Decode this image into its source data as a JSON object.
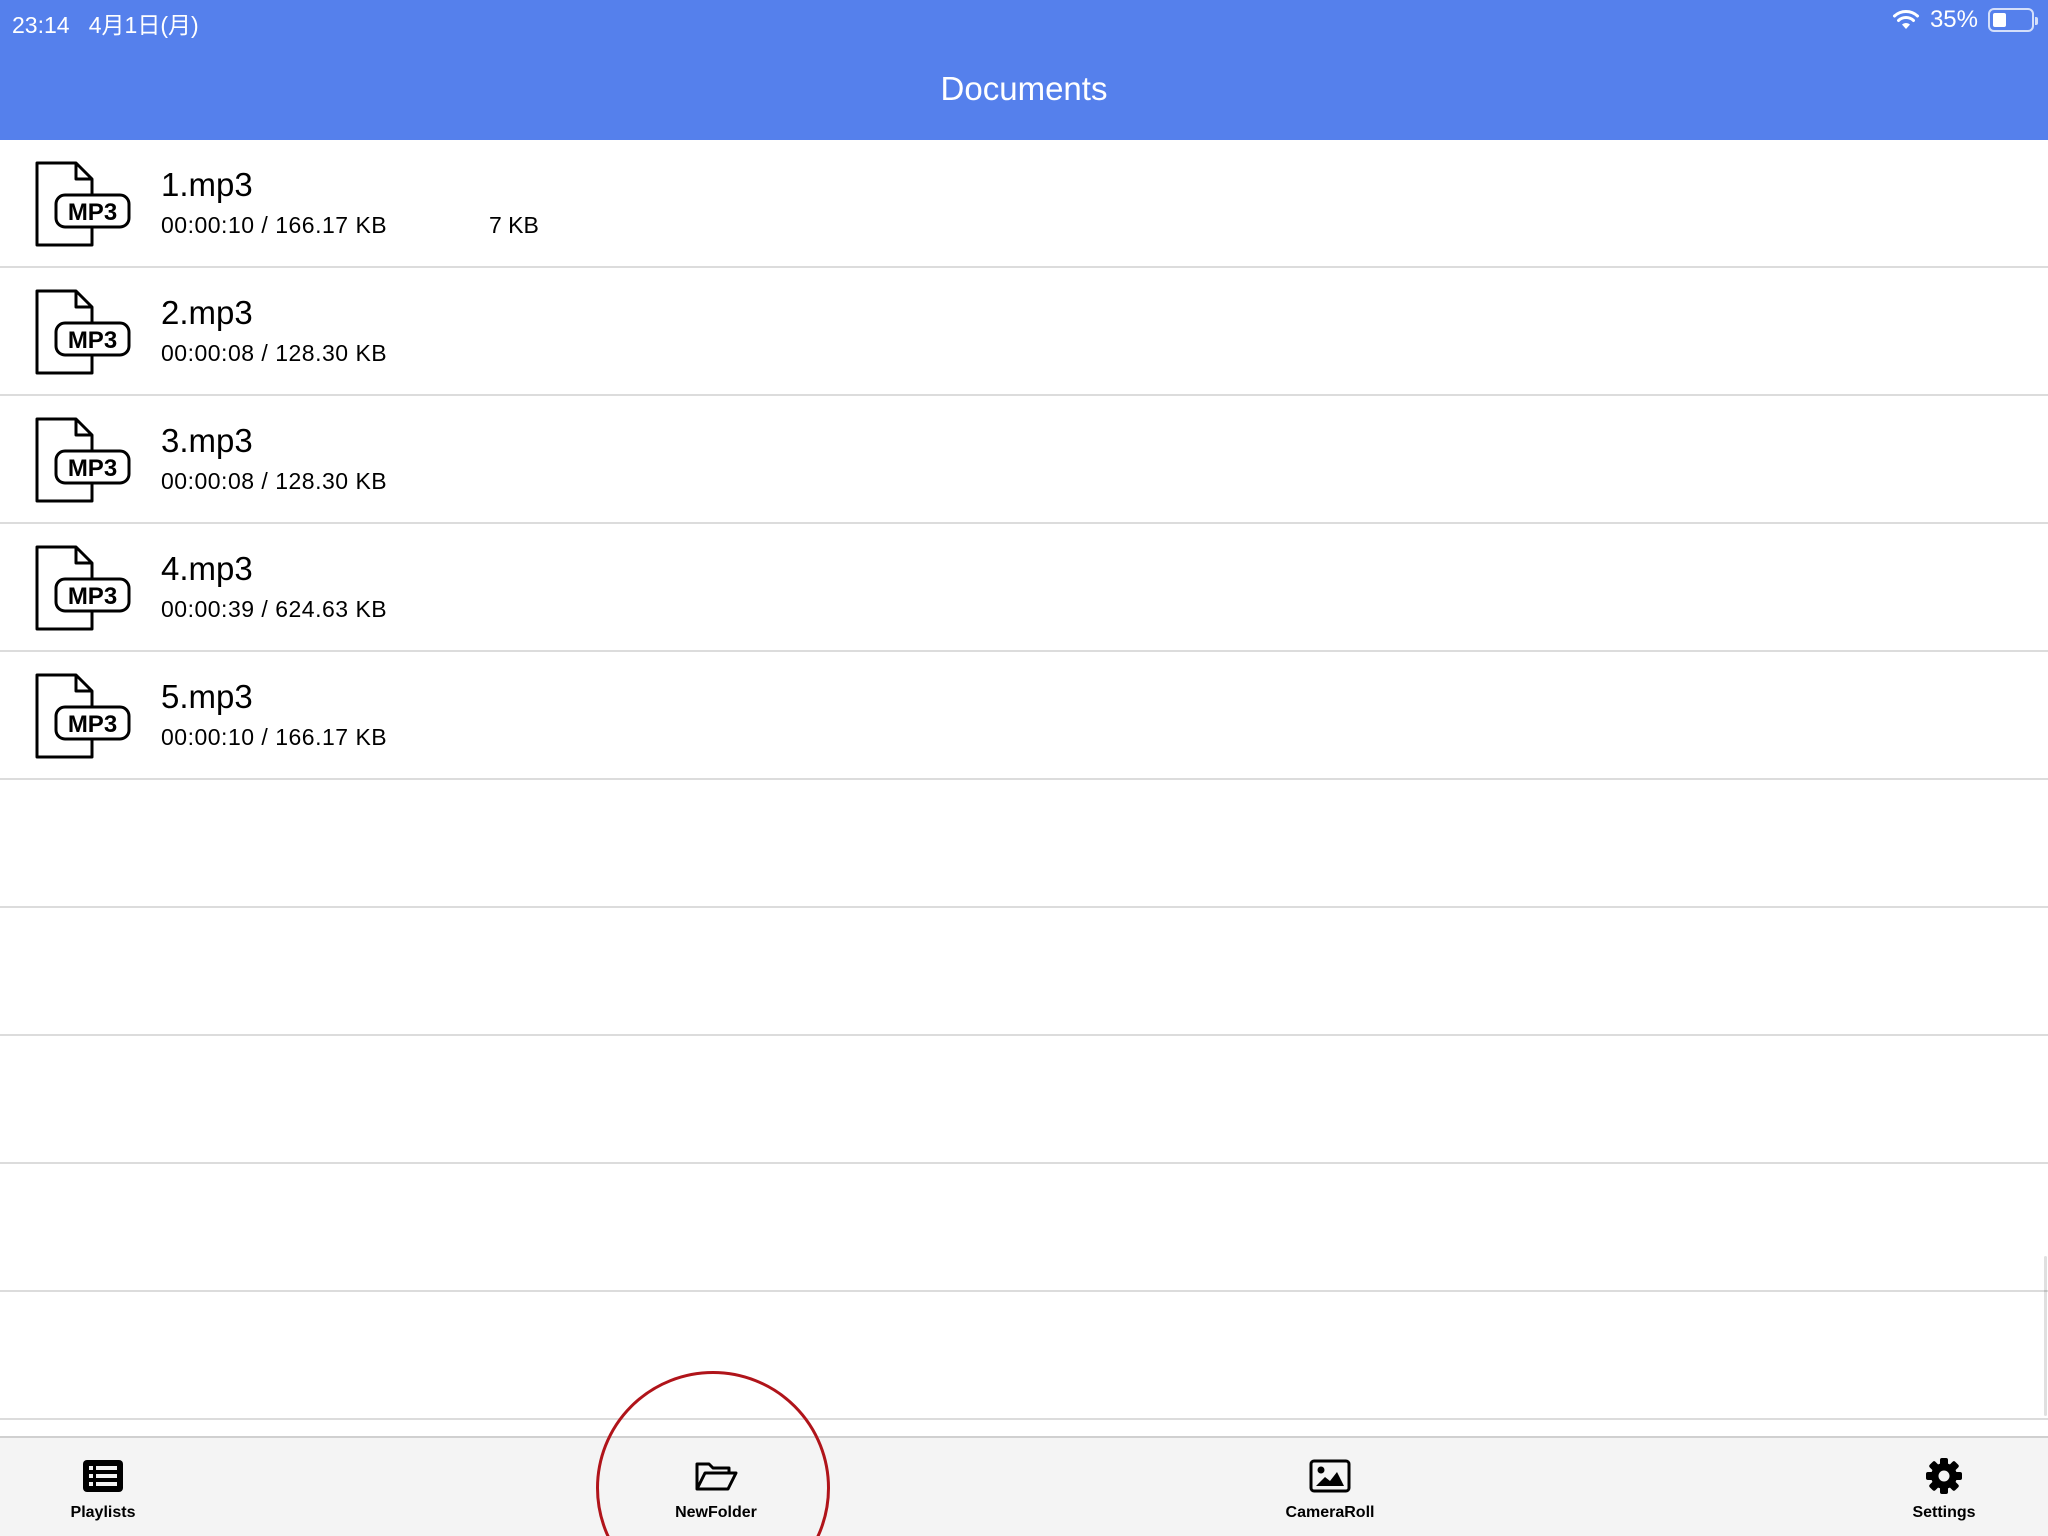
{
  "status_bar": {
    "time": "23:14",
    "date": "4月1日(月)",
    "battery_percent": "35%",
    "battery_level": 0.35
  },
  "header": {
    "title": "Documents",
    "background_color": "#5580ec"
  },
  "files": [
    {
      "name": "1.mp3",
      "meta": "00:00:10 / 166.17 KB",
      "extra": "7 KB",
      "icon": "mp3-file-icon",
      "icon_label": "MP3"
    },
    {
      "name": "2.mp3",
      "meta": "00:00:08 / 128.30 KB",
      "extra": "",
      "icon": "mp3-file-icon",
      "icon_label": "MP3"
    },
    {
      "name": "3.mp3",
      "meta": "00:00:08 / 128.30 KB",
      "extra": "",
      "icon": "mp3-file-icon",
      "icon_label": "MP3"
    },
    {
      "name": "4.mp3",
      "meta": "00:00:39 / 624.63 KB",
      "extra": "",
      "icon": "mp3-file-icon",
      "icon_label": "MP3"
    },
    {
      "name": "5.mp3",
      "meta": "00:00:10 / 166.17 KB",
      "extra": "",
      "icon": "mp3-file-icon",
      "icon_label": "MP3"
    }
  ],
  "tabbar": {
    "tabs": [
      {
        "label": "Playlists",
        "icon": "list-icon"
      },
      {
        "label": "NewFolder",
        "icon": "folder-open-icon"
      },
      {
        "label": "CameraRoll",
        "icon": "image-icon"
      },
      {
        "label": "Settings",
        "icon": "gear-icon"
      }
    ]
  },
  "annotation": {
    "highlight_color": "#b0141a"
  }
}
